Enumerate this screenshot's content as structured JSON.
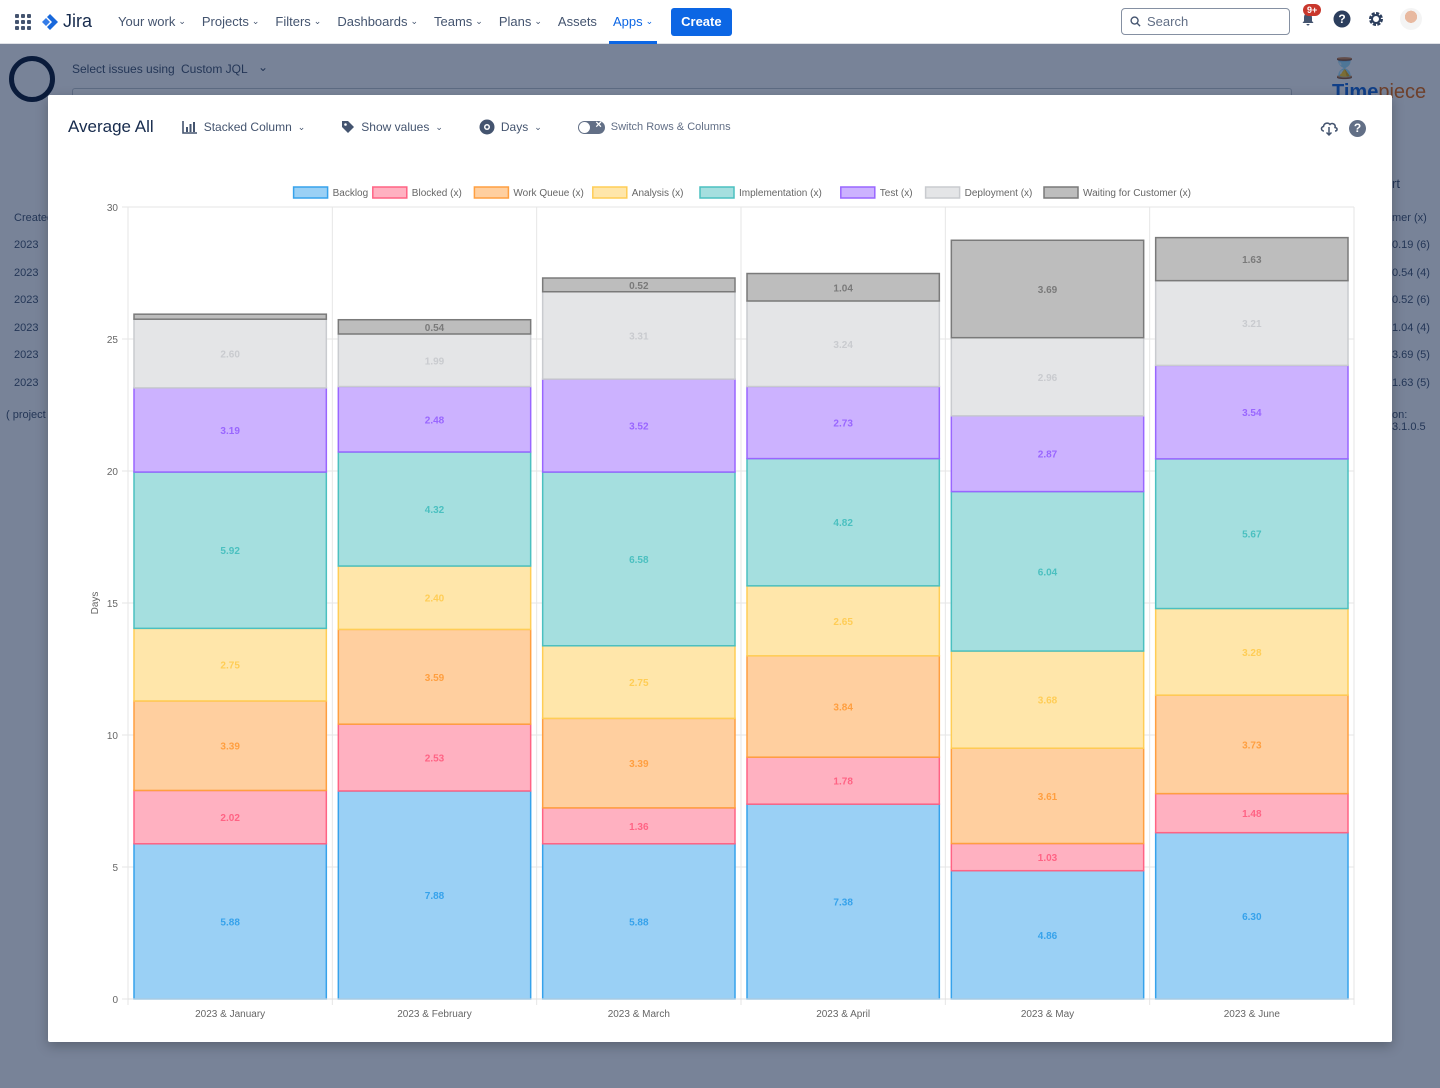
{
  "topnav": {
    "app_name": "Jira",
    "items": [
      {
        "label": "Your work",
        "dropdown": true
      },
      {
        "label": "Projects",
        "dropdown": true
      },
      {
        "label": "Filters",
        "dropdown": true
      },
      {
        "label": "Dashboards",
        "dropdown": true
      },
      {
        "label": "Teams",
        "dropdown": true
      },
      {
        "label": "Plans",
        "dropdown": true
      },
      {
        "label": "Assets",
        "dropdown": false
      },
      {
        "label": "Apps",
        "dropdown": true,
        "active": true
      }
    ],
    "create_label": "Create",
    "search_placeholder": "Search",
    "notifications_badge": "9+"
  },
  "background": {
    "select_label": "Select issues using",
    "select_value": "Custom JQL",
    "brand_prefix": "Time",
    "brand_suffix": "piece",
    "left_col_header": "Created",
    "left_col_values": [
      "2023",
      "2023",
      "2023",
      "2023",
      "2023",
      "2023"
    ],
    "left_footer": "( project i",
    "right_col_header": "mer (x)",
    "right_col_values": [
      "0.19 (6)",
      "0.54 (4)",
      "0.52 (6)",
      "1.04 (4)",
      "3.69 (5)",
      "1.63 (5)"
    ],
    "right_footer": "on: 3.1.0.5",
    "right_dropdown": "rt"
  },
  "modal": {
    "title": "Average All",
    "chart_type_label": "Stacked Column",
    "show_values_label": "Show values",
    "unit_label": "Days",
    "switch_label": "Switch Rows & Columns"
  },
  "colors": {
    "accent": "#0c66e4"
  },
  "chart_data": {
    "type": "bar",
    "stacked": true,
    "title": "",
    "xlabel": "",
    "ylabel": "Days",
    "ylim": [
      0,
      30
    ],
    "yticks": [
      0,
      5,
      10,
      15,
      20,
      25,
      30
    ],
    "grid": true,
    "legend_position": "top",
    "categories": [
      "2023 & January",
      "2023 & February",
      "2023 & March",
      "2023 & April",
      "2023 & May",
      "2023 & June"
    ],
    "series": [
      {
        "name": "Backlog",
        "fill": "#9ad0f5",
        "stroke": "#36a2eb",
        "text": "#36a2eb",
        "values": [
          5.88,
          7.88,
          5.88,
          7.38,
          4.86,
          6.3
        ]
      },
      {
        "name": "Blocked (x)",
        "fill": "#ffb1c1",
        "stroke": "#ff6384",
        "text": "#ff6384",
        "values": [
          2.02,
          2.53,
          1.36,
          1.78,
          1.03,
          1.48
        ]
      },
      {
        "name": "Work Queue (x)",
        "fill": "#ffcf9f",
        "stroke": "#ff9f40",
        "text": "#ff9f40",
        "values": [
          3.39,
          3.59,
          3.39,
          3.84,
          3.61,
          3.73
        ]
      },
      {
        "name": "Analysis (x)",
        "fill": "#ffe6aa",
        "stroke": "#ffcd56",
        "text": "#ffcd56",
        "values": [
          2.75,
          2.4,
          2.75,
          2.65,
          3.68,
          3.28
        ]
      },
      {
        "name": "Implementation (x)",
        "fill": "#a5dfdf",
        "stroke": "#4bc0c0",
        "text": "#4bc0c0",
        "values": [
          5.92,
          4.32,
          6.58,
          4.82,
          6.04,
          5.67
        ]
      },
      {
        "name": "Test (x)",
        "fill": "#ccb2ff",
        "stroke": "#9966ff",
        "text": "#9966ff",
        "values": [
          3.19,
          2.48,
          3.52,
          2.73,
          2.87,
          3.54
        ]
      },
      {
        "name": "Deployment (x)",
        "fill": "#e4e5e7",
        "stroke": "#c9cbcf",
        "text": "#c9cbcf",
        "values": [
          2.6,
          1.99,
          3.31,
          3.24,
          2.96,
          3.21
        ]
      },
      {
        "name": "Waiting for Customer (x)",
        "fill": "#bdbdbd",
        "stroke": "#7a7a7a",
        "text": "#7a7a7a",
        "values": [
          0.19,
          0.54,
          0.52,
          1.04,
          3.69,
          1.63
        ]
      }
    ]
  }
}
